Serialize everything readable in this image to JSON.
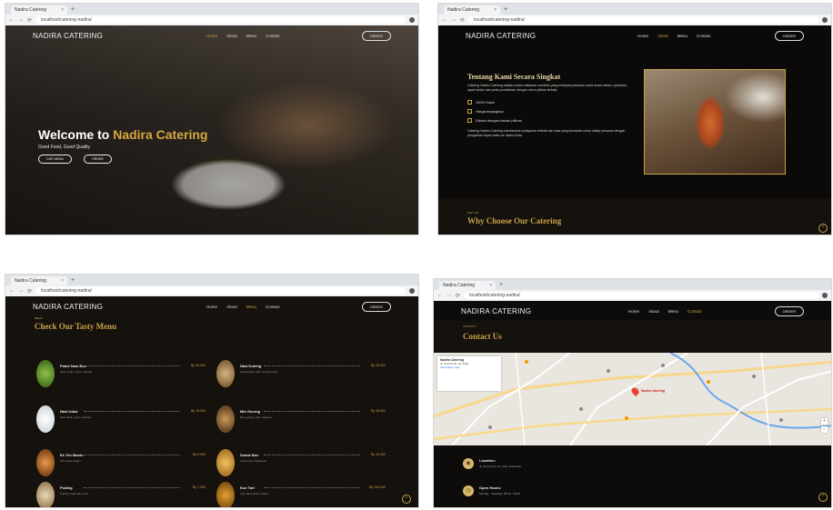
{
  "browser": {
    "tab_title": "Nadira Catering",
    "tab_close": "×",
    "new_tab": "+",
    "url": "localhost/catering-nadira/",
    "back": "←",
    "forward": "→",
    "reload": "⟳"
  },
  "site": {
    "brand": "NADIRA CATERING",
    "nav": [
      "Home",
      "About",
      "Menu",
      "Contact"
    ],
    "order_button": "ORDER"
  },
  "hero": {
    "title_prefix": "Welcome to ",
    "title_highlight": "Nadira Catering",
    "subtitle": "Good Food, Good Quality",
    "btn_menu": "OUR MENU",
    "btn_order": "ORDER"
  },
  "about": {
    "title": "Tentang Kami Secara Singkat",
    "text": "Catering Nadira Catering adalah usaha makanan rumahan yang melayani pesanan untuk acara arisan, syukuran, rapat kantor dan pesta pernikahan dengan menu pilihan terbaik.",
    "checks": [
      "100% Halal",
      "Harga terjangkau",
      "Dibuat dengan bahan pilihan"
    ],
    "text2": "Catering Nadira Catering memberikan pelayanan terbaik dan rasa yang konsisten untuk setiap pesanan dengan pengiriman tepat waktu ke lokasi Anda.",
    "why_small": "WHY US",
    "why_title": "Why Choose Our Catering"
  },
  "menu": {
    "small": "MENU",
    "title": "Check Our Tasty Menu",
    "items": [
      {
        "name": "Paket Nasi Box",
        "price": "Rp 25.000",
        "desc": "Nasi, ayam, sayur, sambal"
      },
      {
        "name": "Nasi Kuning",
        "price": "Rp 15.000",
        "desc": "Nasi kuning, telur, kering tempe"
      },
      {
        "name": "Nasi Uduk",
        "price": "Rp 15.000",
        "desc": "Nasi uduk, ayam, sambal"
      },
      {
        "name": "Mie Goreng",
        "price": "Rp 15.000",
        "desc": "Mie goreng, telur, sayuran"
      },
      {
        "name": "Es Teh Manis",
        "price": "Rp 5.000",
        "desc": "Teh manis dingin"
      },
      {
        "name": "Snack Box",
        "price": "Rp 10.000",
        "desc": "Aneka kue tradisional"
      },
      {
        "name": "Puding",
        "price": "Rp 7.000",
        "desc": "Puding coklat dan susu"
      },
      {
        "name": "Kue Tart",
        "price": "Rp 150.000",
        "desc": "Kue ulang tahun coklat"
      }
    ]
  },
  "contact": {
    "small": "CONTACT",
    "title": "Contact Us",
    "map_card_title": "Nadira Catering",
    "map_card_address": "Jl. Contoh No. 12, Kota",
    "map_card_link": "View larger map",
    "pin_label": "Nadira Catering",
    "zoom_in": "+",
    "zoom_out": "−",
    "location_title": "Location:",
    "location_detail": "Jl. Contoh No. 12, Kota, Indonesia",
    "hours_title": "Open Hours:",
    "hours_detail": "Monday - Saturday: 08.00 - 20.00"
  },
  "colors": {
    "gold": "#c9a24a",
    "background": "#0e0c0a"
  }
}
